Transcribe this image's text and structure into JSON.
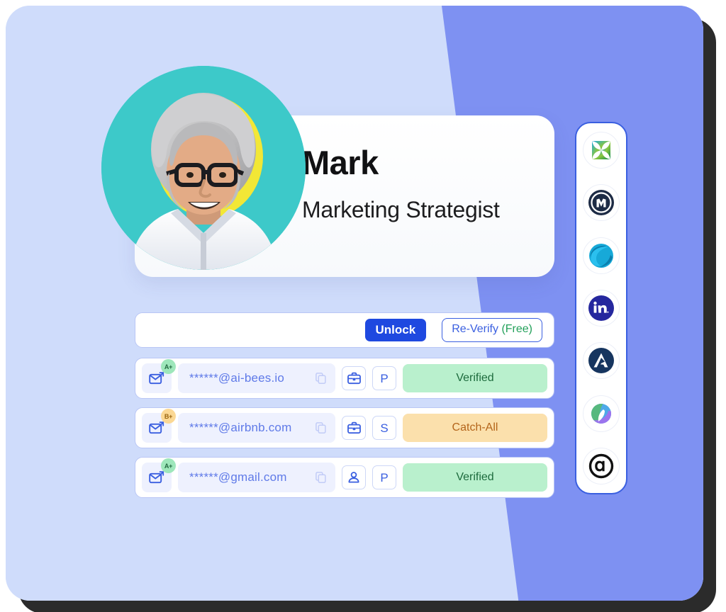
{
  "profile": {
    "name": "Mark",
    "title": "Marketing Strategist",
    "avatar_icon": "person-photo"
  },
  "action_bar": {
    "unlock_label": "Unlock",
    "reverify_label": "Re-Verify",
    "reverify_free_suffix": " (Free)"
  },
  "emails": [
    {
      "mail_icon": "email-open-icon",
      "grade": "A+",
      "grade_type": "green",
      "address": "******@ai-bees.io",
      "copy_icon": "copy-icon",
      "type_icon": "briefcase-icon",
      "type_label": "work",
      "source_letter": "P",
      "status": "Verified",
      "status_type": "verified"
    },
    {
      "mail_icon": "email-open-icon",
      "grade": "B+",
      "grade_type": "amber",
      "address": "******@airbnb.com",
      "copy_icon": "copy-icon",
      "type_icon": "briefcase-icon",
      "type_label": "work",
      "source_letter": "S",
      "status": "Catch-All",
      "status_type": "catchall"
    },
    {
      "mail_icon": "email-open-icon",
      "grade": "A+",
      "grade_type": "green",
      "address": "******@gmail.com",
      "copy_icon": "copy-icon",
      "type_icon": "person-icon",
      "type_label": "personal",
      "source_letter": "P",
      "status": "Verified",
      "status_type": "verified"
    }
  ],
  "integration_rail": {
    "items": [
      {
        "name": "zoominfo-logo-icon"
      },
      {
        "name": "lusha-logo-icon"
      },
      {
        "name": "seamless-ai-logo-icon"
      },
      {
        "name": "moodle-logo-icon"
      },
      {
        "name": "apollo-logo-icon"
      },
      {
        "name": "clearbit-logo-icon"
      },
      {
        "name": "adapt-logo-icon"
      }
    ]
  },
  "colors": {
    "accent_blue": "#1f49e0",
    "link_blue": "#3a5fe0",
    "background_light": "#cfdcfb",
    "background_wedge": "#7e91f2",
    "avatar_bg": "#3dc9c9",
    "verified_green": "#b9f0cd",
    "catchall_amber": "#fbe0ac"
  }
}
